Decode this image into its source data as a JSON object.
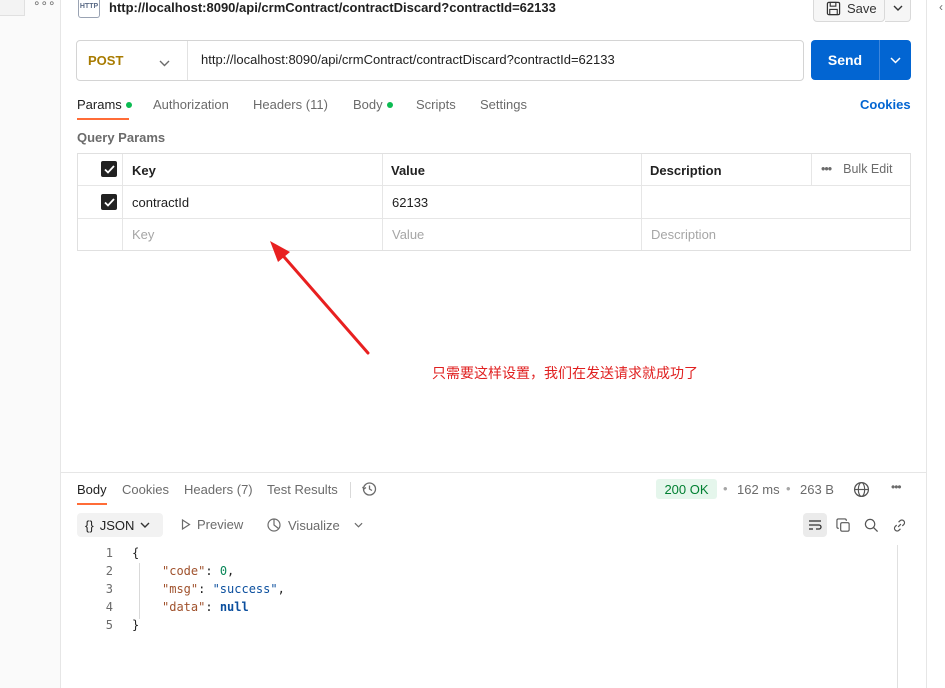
{
  "header": {
    "http_icon_text": "HTTP",
    "title": "http://localhost:8090/api/crmContract/contractDiscard?contractId=62133",
    "save_label": "Save"
  },
  "request": {
    "method": "POST",
    "url": "http://localhost:8090/api/crmContract/contractDiscard?contractId=62133",
    "send_label": "Send",
    "colors": {
      "send": "#0265d2",
      "method": "#a87b00",
      "accent": "#ff6c37"
    }
  },
  "tabs": [
    {
      "label": "Params",
      "dot": true
    },
    {
      "label": "Authorization",
      "dot": false
    },
    {
      "label": "Headers (11)",
      "dot": false
    },
    {
      "label": "Body",
      "dot": true
    },
    {
      "label": "Scripts",
      "dot": false
    },
    {
      "label": "Settings",
      "dot": false
    }
  ],
  "cookies_label": "Cookies",
  "query_params": {
    "title": "Query Params",
    "columns": [
      "Key",
      "Value",
      "Description"
    ],
    "bulk_edit_label": "Bulk Edit",
    "rows": [
      {
        "checked": true,
        "key": "contractId",
        "value": "62133",
        "description": ""
      }
    ],
    "placeholders": {
      "key": "Key",
      "value": "Value",
      "description": "Description"
    }
  },
  "annotation": {
    "text": "只需要这样设置，我们在发送请求就成功了",
    "color": "#e02020"
  },
  "response": {
    "tabs": [
      "Body",
      "Cookies",
      "Headers (7)",
      "Test Results"
    ],
    "status": "200 OK",
    "time": "162 ms",
    "size": "263 B",
    "format": "JSON",
    "preview_label": "Preview",
    "visualize_label": "Visualize",
    "lines": [
      {
        "n": "1",
        "text": "{"
      },
      {
        "n": "2",
        "key": "\"code\"",
        "value": "0",
        "type": "num",
        "comma": true
      },
      {
        "n": "3",
        "key": "\"msg\"",
        "value": "\"success\"",
        "type": "str",
        "comma": true
      },
      {
        "n": "4",
        "key": "\"data\"",
        "value": "null",
        "type": "kw",
        "comma": false
      },
      {
        "n": "5",
        "text": "}"
      }
    ]
  },
  "icons": [
    "http-icon",
    "save-icon",
    "chevron-down-icon",
    "checkbox-checked-icon",
    "history-icon",
    "globe-icon",
    "more-icon",
    "braces-icon",
    "play-icon",
    "visualize-icon",
    "wrap-icon",
    "copy-icon",
    "search-icon",
    "link-icon"
  ]
}
